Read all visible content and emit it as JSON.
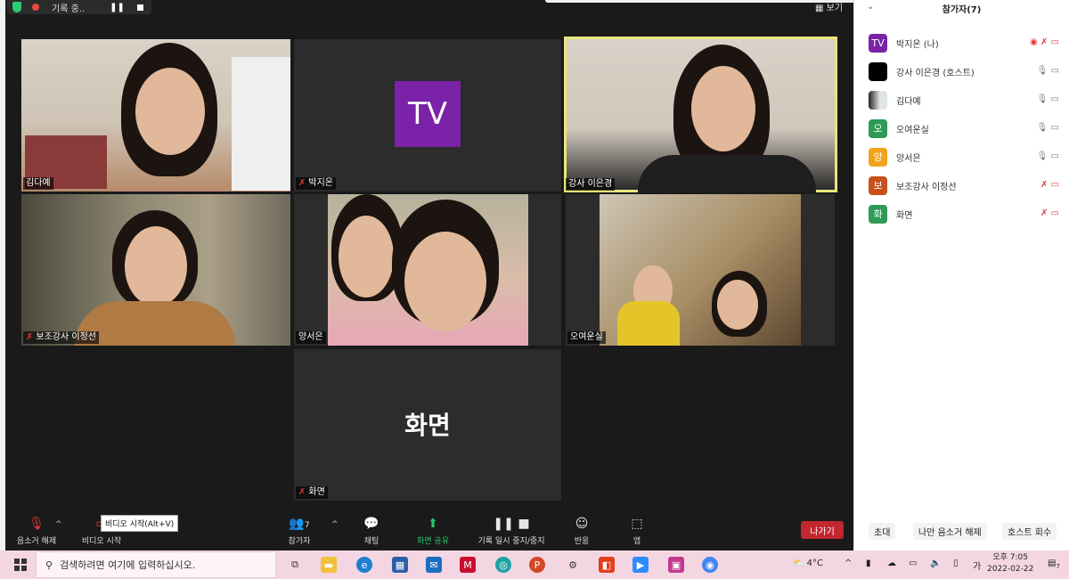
{
  "recording": {
    "label": "기록 중..",
    "pause_icon": "pause-icon",
    "stop_icon": "stop-icon"
  },
  "view_button": "▦ 보기",
  "tiles": {
    "kim": {
      "name": "김다예"
    },
    "park": {
      "name": "박지온",
      "avatar": "TV",
      "avatar_color": "#7a22a8"
    },
    "teacher": {
      "name": "강사 이은경"
    },
    "assistant": {
      "name": "보조강사 이정선"
    },
    "yang": {
      "name": "양서은"
    },
    "oh": {
      "name": "오여운실"
    },
    "screen": {
      "name": "화면",
      "center_text": "화면"
    }
  },
  "toolbar": {
    "mute": "음소거 해제",
    "video": "비디오 시작",
    "video_tooltip": "비디오 시작(Alt+V)",
    "participants": "참가자",
    "participants_count": "7",
    "chat": "채팅",
    "share": "화면 공유",
    "record": "기록 일시 중지/중지",
    "reactions": "반응",
    "apps": "앱",
    "leave": "나가기"
  },
  "panel": {
    "title": "참가자(7)",
    "participants": [
      {
        "avatar": "TV",
        "color": "#7a22a8",
        "name": "박지온 (나)",
        "mic_muted": true,
        "video_off": true
      },
      {
        "avatar": "",
        "color": "#000000",
        "name": "강사 이은경 (호스트)",
        "mic_muted": false,
        "video_off": false
      },
      {
        "avatar": "",
        "color": "#dfe6e0",
        "name": "김다예",
        "mic_muted": false,
        "video_off": false
      },
      {
        "avatar": "오",
        "color": "#2e9b57",
        "name": "오여운실",
        "mic_muted": false,
        "video_off": false
      },
      {
        "avatar": "양",
        "color": "#f2a31b",
        "name": "양서은",
        "mic_muted": false,
        "video_off": false
      },
      {
        "avatar": "보",
        "color": "#c9501c",
        "name": "보조강사 이정선",
        "mic_muted": true,
        "video_off": true
      },
      {
        "avatar": "화",
        "color": "#2e9b57",
        "name": "화면",
        "mic_muted": true,
        "video_off": true
      }
    ],
    "invite": "초대",
    "unmute_me": "나만 음소거 해제",
    "reclaim_host": "호스트 회수"
  },
  "taskbar": {
    "search_placeholder": "검색하려면 여기에 입력하십시오.",
    "weather": "4°C",
    "ime": "가",
    "time": "오후 7:05",
    "date": "2022-02-22",
    "notification_count": "7"
  }
}
